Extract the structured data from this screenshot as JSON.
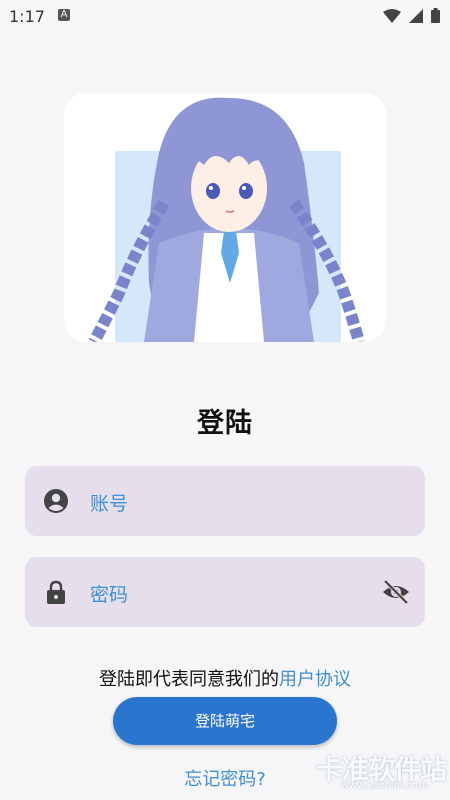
{
  "status_bar": {
    "time": "1:17",
    "notification_icon": "A"
  },
  "hero_image": {
    "description_icon": "anime-girl-illustration"
  },
  "page": {
    "title": "登陆"
  },
  "account_field": {
    "placeholder": "账号",
    "icon": "account-circle-icon"
  },
  "password_field": {
    "placeholder": "密码",
    "icon": "lock-icon",
    "toggle_icon": "visibility-off-icon"
  },
  "agreement": {
    "text": "登陆即代表同意我们的",
    "link": "用户协议"
  },
  "login_button": {
    "label": "登陆萌宅"
  },
  "forgot_link": {
    "label": "忘记密码?"
  },
  "watermark": {
    "text": "卡准软件站",
    "url": "www.kazhun.com"
  },
  "colors": {
    "accent": "#2a76cf",
    "link": "#3f8fd6",
    "field_bg": "#e6deeb",
    "background": "#f6f6f8"
  }
}
